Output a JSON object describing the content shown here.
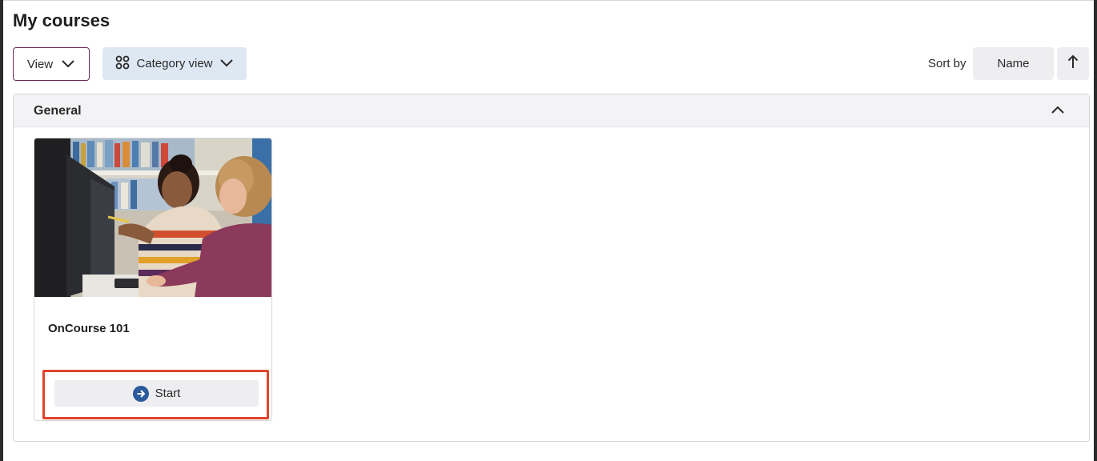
{
  "page": {
    "title": "My courses"
  },
  "toolbar": {
    "view_label": "View",
    "category_view_label": "Category view",
    "sort_by_label": "Sort by",
    "sort_field": "Name",
    "sort_direction_icon": "arrow-up-icon"
  },
  "category": {
    "title": "General",
    "expanded": true,
    "courses": [
      {
        "name": "OnCourse 101",
        "action_label": "Start",
        "action_icon": "arrow-right-circle-icon"
      }
    ]
  },
  "colors": {
    "accent_border": "#6b2a5e",
    "category_view_bg": "#dde8f3",
    "start_icon": "#2c5a9c",
    "highlight": "#e0442c"
  }
}
